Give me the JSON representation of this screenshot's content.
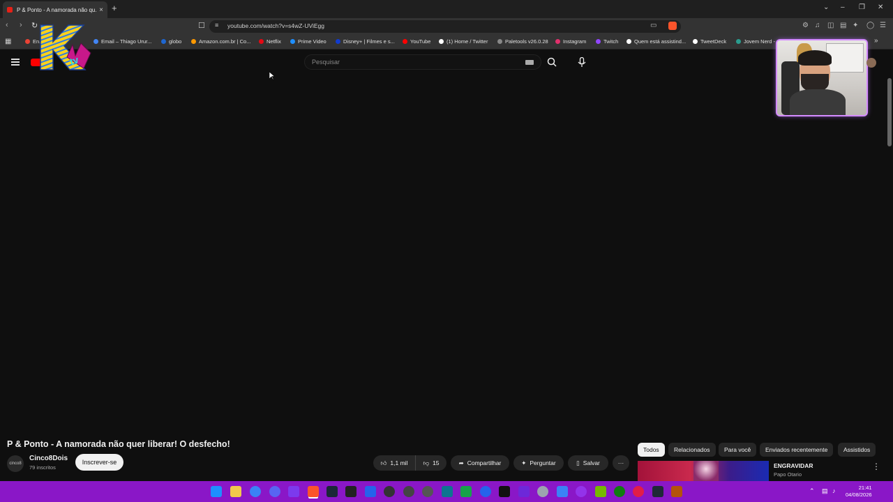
{
  "browser": {
    "tab_title": "P & Ponto - A namorada não qu...",
    "tab_close": "×",
    "new_tab": "+",
    "window_controls": [
      "⌄",
      "–",
      "❐",
      "✕"
    ],
    "url": "youtube.com/watch?v=s4wZ-UViEgg"
  },
  "bookmarks": [
    {
      "label": "En...",
      "color": "#ea4335"
    },
    {
      "label": "Email – Thiago Urur...",
      "color": "#4285f4"
    },
    {
      "label": "globo",
      "color": "#1e66d0"
    },
    {
      "label": "Amazon.com.br | Co...",
      "color": "#ff9900"
    },
    {
      "label": "Netflix",
      "color": "#e50914"
    },
    {
      "label": "Prime Video",
      "color": "#1f8fff"
    },
    {
      "label": "Disney+ | Filmes e s...",
      "color": "#113ccf"
    },
    {
      "label": "YouTube",
      "color": "#ff0000"
    },
    {
      "label": "(1) Home / Twitter",
      "color": "#ffffff"
    },
    {
      "label": "Paletools v26.0.28",
      "color": "#888888"
    },
    {
      "label": "Instagram",
      "color": "#e1306c"
    },
    {
      "label": "Twitch",
      "color": "#9146ff"
    },
    {
      "label": "Quem está assistind...",
      "color": "#ffffff"
    },
    {
      "label": "TweetDeck",
      "color": "#ffffff"
    },
    {
      "label": "Jovem Nerd - ...",
      "color": "#2a9d8f"
    }
  ],
  "youtube": {
    "search_placeholder": "Pesquisar",
    "video_title": "P & Ponto - A namorada não quer liberar! O desfecho!",
    "channel_name": "Cinco8Dois",
    "channel_avatar_text": "cinco8",
    "subscribers": "79 inscritos",
    "subscribe_label": "Inscrever-se",
    "likes": "1,1 mil",
    "dislikes": "15",
    "share_label": "Compartilhar",
    "ask_label": "Perguntar",
    "save_label": "Salvar",
    "more_label": "···",
    "chips": [
      "Todos",
      "Relacionados",
      "Para você",
      "Enviados recentemente",
      "Assistidos"
    ],
    "suggestion": {
      "title": "ENGRAVIDAR",
      "channel": "Papo Otario"
    }
  },
  "overlay": {
    "logo_text": "KTV"
  },
  "taskbar": {
    "time": "21:41",
    "date": "04/08/2026"
  },
  "colors": {
    "taskbar": "#8a17c7",
    "youtube_red": "#ff0000",
    "background": "#0f0f0f"
  }
}
